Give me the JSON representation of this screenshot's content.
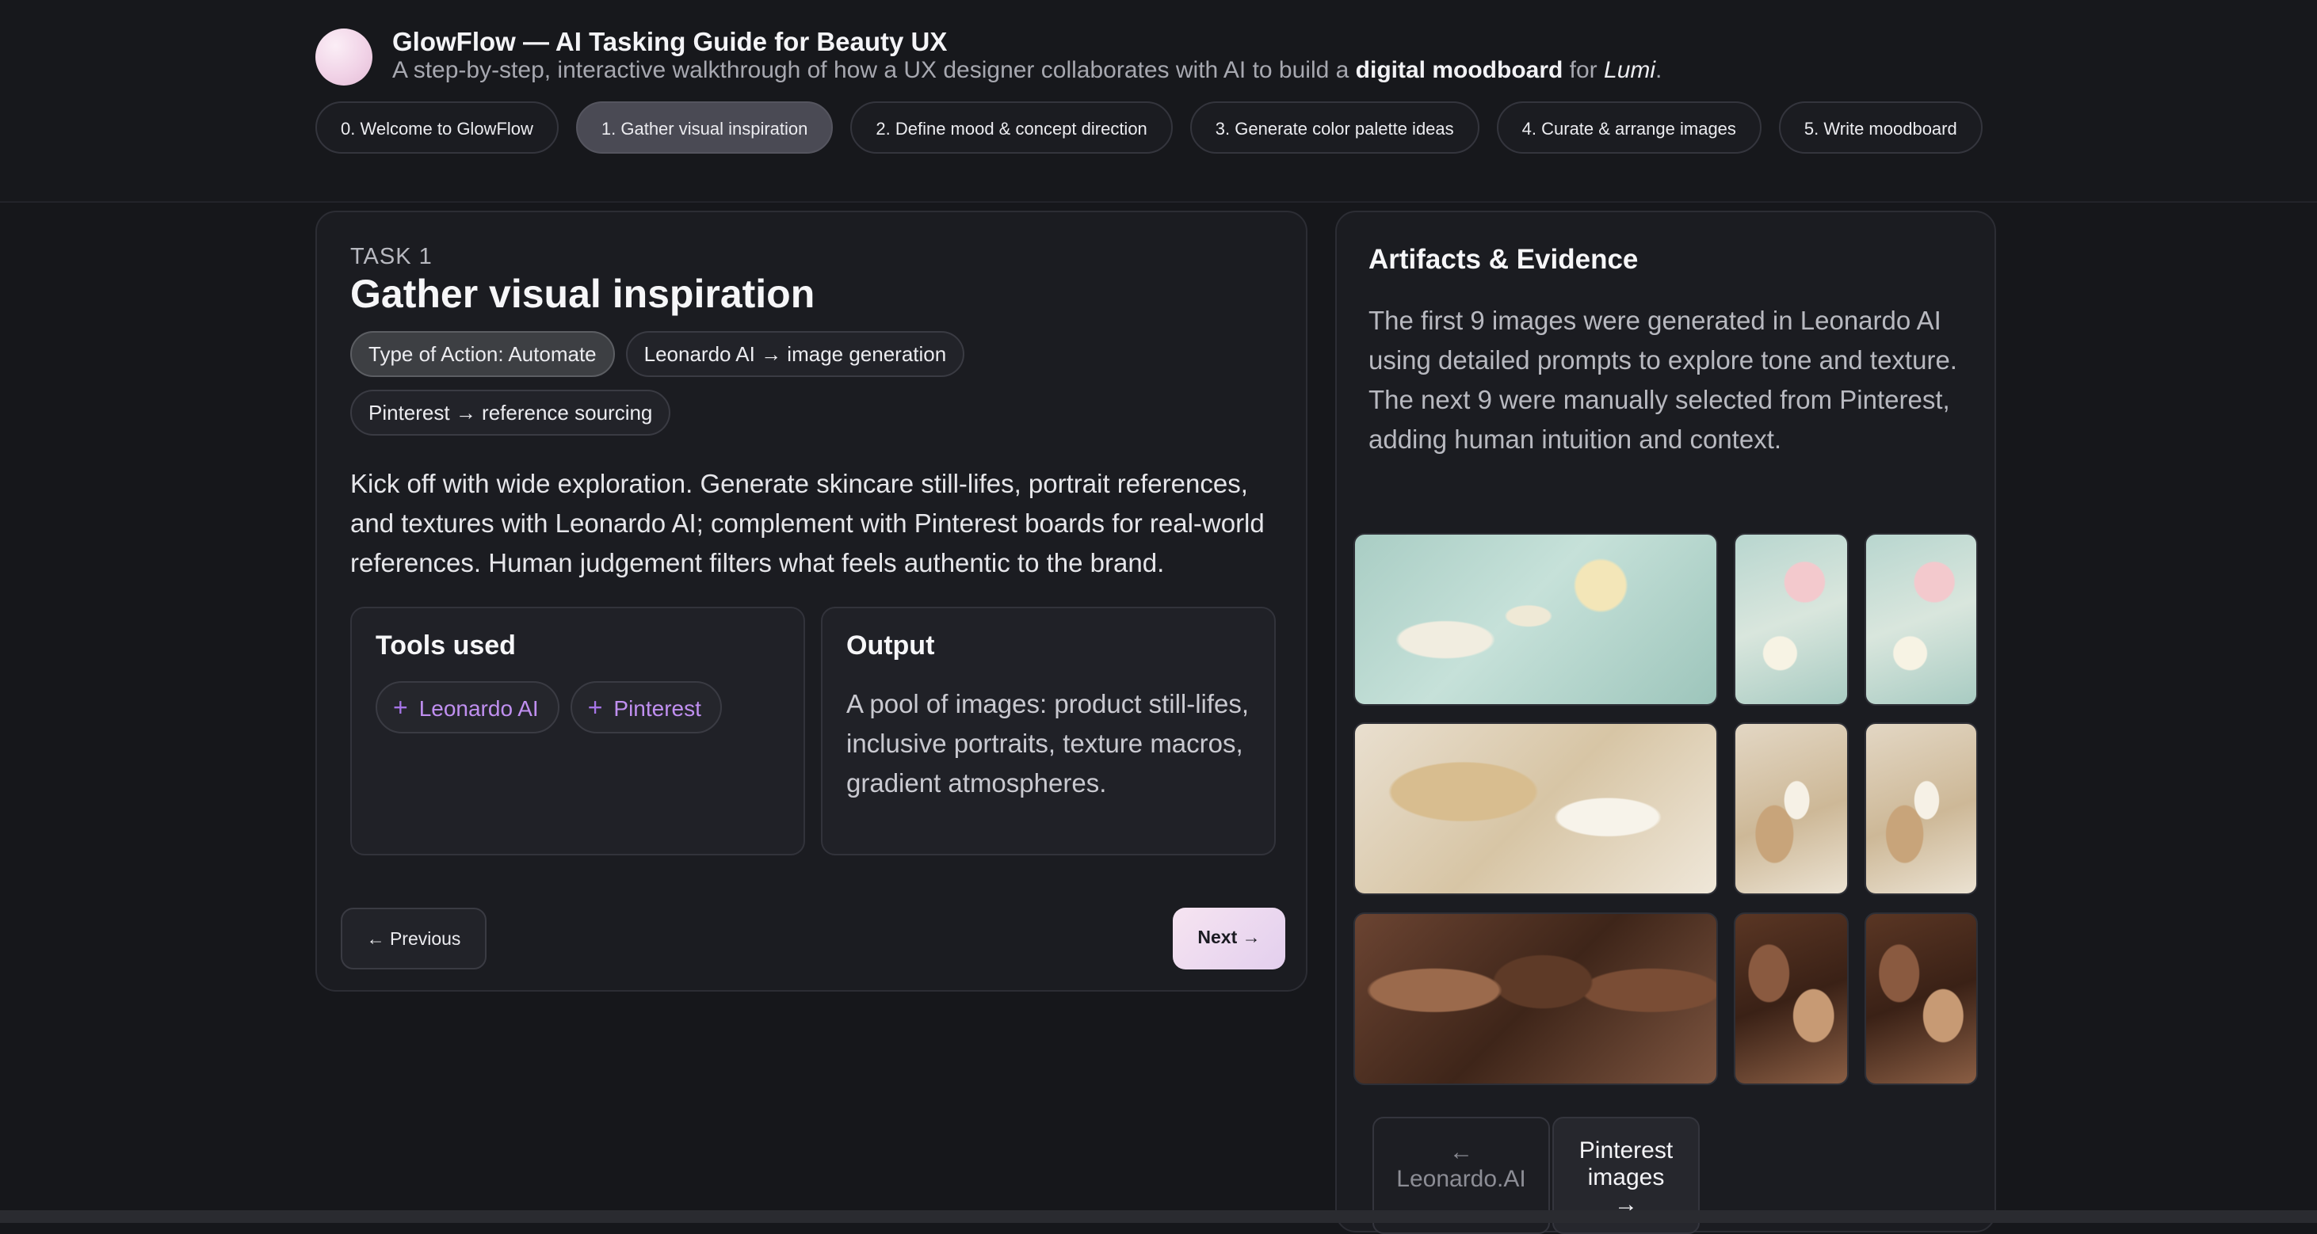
{
  "header": {
    "title": "GlowFlow — AI Tasking Guide for Beauty UX",
    "subtitle_pre": "A step-by-step, interactive walkthrough of how a UX designer collaborates with AI to build a ",
    "subtitle_em": "digital moodboard",
    "subtitle_mid": " for ",
    "subtitle_brand": "Lumi",
    "subtitle_end": "."
  },
  "steps": [
    {
      "label": "0. Welcome to GlowFlow",
      "active": false
    },
    {
      "label": "1. Gather visual inspiration",
      "active": true
    },
    {
      "label": "2. Define mood & concept direction",
      "active": false
    },
    {
      "label": "3. Generate color palette ideas",
      "active": false
    },
    {
      "label": "4. Curate & arrange images",
      "active": false
    },
    {
      "label": "5. Write moodboard",
      "active": false
    }
  ],
  "task": {
    "label": "TASK 1",
    "title": "Gather visual inspiration",
    "chips": [
      "Type of Action: Automate",
      "Leonardo AI → image generation",
      "Pinterest → reference sourcing"
    ],
    "description": "Kick off with wide exploration. Generate skincare still-lifes, portrait references, and textures with Leonardo AI; complement with Pinterest boards for real-world references. Human judgement filters what feels authentic to the brand.",
    "tools_title": "Tools used",
    "tools": [
      "Leonardo AI",
      "Pinterest"
    ],
    "output_title": "Output",
    "output_text": "A pool of images: product still-lifes, inclusive portraits, texture macros, gradient atmospheres.",
    "prev_label": "← Previous",
    "next_label": "Next →"
  },
  "artifacts": {
    "title": "Artifacts & Evidence",
    "text": "The first 9 images were generated in Leonardo AI using detailed prompts to explore tone and texture. The next 9 were manually selected from Pinterest, adding human intuition and context.",
    "images": [
      "skincare still-life with roses and aloe",
      "pink flowers and aloe on mint",
      "daisies and petals on mint",
      "serum bottle with dried flowers on marble",
      "skincare products flat lay",
      "serum bottle with dried flowers",
      "group portrait of women holding serums",
      "group portrait of smiling women",
      "group portrait with skincare products"
    ],
    "pager_prev_arrow": "←",
    "pager_prev_label": "Leonardo.AI",
    "pager_next_label": "Pinterest images",
    "pager_next_arrow": "→"
  },
  "colors": {
    "background": "#16171b",
    "card": "#1b1c21",
    "accent_purple": "#c08ff0",
    "next_gradient_start": "#f6e4f1",
    "next_gradient_end": "#e3cfee"
  }
}
